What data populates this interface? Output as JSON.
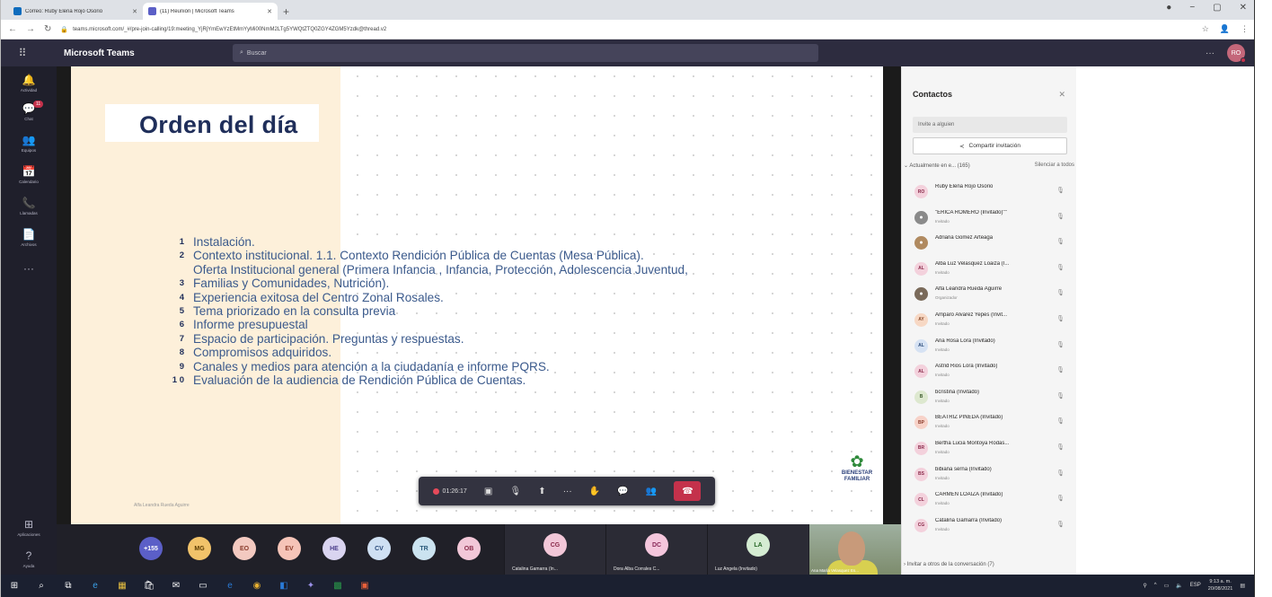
{
  "browser": {
    "tabs": [
      {
        "title": "Correo: Ruby Elena Rojo Osorio",
        "color": "#0f6cbd",
        "active": false
      },
      {
        "title": "(11) Reunión | Microsoft Teams",
        "color": "#5b5fc7",
        "active": true
      }
    ],
    "url": "teams.microsoft.com/_#/pre-join-calling/19:meeting_YjRjYmEwYzEtMmYyMi00NmM2LTg5YWQtZTQ0ZGY4ZGM5Yzdk@thread.v2"
  },
  "teams": {
    "app_title": "Microsoft Teams",
    "search_placeholder": "Buscar",
    "me_initials": "RO"
  },
  "rail": [
    {
      "label": "Actividad",
      "icon": "bell-icon",
      "glyph": "🔔"
    },
    {
      "label": "Chat",
      "icon": "chat-icon",
      "glyph": "💬",
      "badge": "11"
    },
    {
      "label": "Equipos",
      "icon": "teams-icon",
      "glyph": "👥"
    },
    {
      "label": "Calendario",
      "icon": "calendar-icon",
      "glyph": "📅"
    },
    {
      "label": "Llamadas",
      "icon": "phone-icon",
      "glyph": "📞"
    },
    {
      "label": "Archivos",
      "icon": "files-icon",
      "glyph": "📄"
    },
    {
      "label": "",
      "icon": "more-icon",
      "glyph": "···"
    }
  ],
  "rail_bottom": [
    {
      "label": "Aplicaciones",
      "icon": "apps-icon",
      "glyph": "⊞"
    },
    {
      "label": "Ayuda",
      "icon": "help-icon",
      "glyph": "?"
    }
  ],
  "slide": {
    "title": "Orden del día",
    "presenter_label": "Alfa Leandra Rueda Aguirre",
    "agenda": [
      {
        "num": "1",
        "text": "Instalación."
      },
      {
        "num": "2",
        "text": "Contexto institucional. 1.1. Contexto Rendición Pública de Cuentas (Mesa Pública)."
      },
      {
        "num": "",
        "text": "Oferta Institucional general (Primera Infancia , Infancia, Protección, Adolescencia Juventud,"
      },
      {
        "num": "3",
        "text": "Familias y Comunidades, Nutrición)."
      },
      {
        "num": "4",
        "text": "Experiencia exitosa del Centro Zonal Rosales."
      },
      {
        "num": "5",
        "text": "Tema priorizado en la consulta previa"
      },
      {
        "num": "6",
        "text": "Informe presupuestal"
      },
      {
        "num": "7",
        "text": "Espacio de participación. Preguntas y respuestas."
      },
      {
        "num": "8",
        "text": "Compromisos adquiridos."
      },
      {
        "num": "9",
        "text": "Canales y medios para atención a la ciudadanía e informe PQRS."
      },
      {
        "num": "1 0",
        "text": "Evaluación de la audiencia de Rendición Pública de Cuentas."
      }
    ],
    "logo_line1": "BIENESTAR",
    "logo_line2": "FAMILIAR",
    "colorbar": [
      "#e87a2a",
      "#47a247",
      "#3b8fd6"
    ]
  },
  "call_toolbar": {
    "timer": "01:26:17",
    "buttons": [
      {
        "name": "camera-off-button",
        "icon": "camera-off-icon",
        "glyph": "▣"
      },
      {
        "name": "mic-off-button",
        "icon": "mic-off-icon",
        "glyph": "🎙"
      },
      {
        "name": "share-button",
        "icon": "share-screen-icon",
        "glyph": "⬆"
      },
      {
        "name": "more-actions-button",
        "icon": "more-icon",
        "glyph": "···"
      },
      {
        "name": "raise-hand-button",
        "icon": "hand-icon",
        "glyph": "✋"
      },
      {
        "name": "chat-button",
        "icon": "chat-icon",
        "glyph": "💬"
      },
      {
        "name": "participants-button",
        "icon": "people-icon",
        "glyph": "👥"
      }
    ],
    "hangup_icon": "phone-hangup-icon"
  },
  "strip": {
    "avatars": [
      {
        "initials": "+155",
        "bg": "#5b5fc7",
        "fg": "#ffffff"
      },
      {
        "initials": "MG",
        "bg": "#f1c36a",
        "fg": "#5a3b00"
      },
      {
        "initials": "EO",
        "bg": "#f3c9c0",
        "fg": "#8a3a2a"
      },
      {
        "initials": "EV",
        "bg": "#f6c4b8",
        "fg": "#8a3a2a"
      },
      {
        "initials": "HE",
        "bg": "#d9d4f0",
        "fg": "#4a3d8a"
      },
      {
        "initials": "CV",
        "bg": "#cfe0f3",
        "fg": "#2a4a7a"
      },
      {
        "initials": "TR",
        "bg": "#cbe3f0",
        "fg": "#2a5a7a"
      },
      {
        "initials": "OB",
        "bg": "#f2c7d8",
        "fg": "#8a2a4a"
      }
    ],
    "tiles": [
      {
        "initials": "CG",
        "bg": "#f2c7d8",
        "fg": "#8a2a4a",
        "name": "Catalina Gamarra (In..."
      },
      {
        "initials": "DC",
        "bg": "#f4c6dc",
        "fg": "#8a2a5a",
        "name": "Dora Alba Corrales C..."
      },
      {
        "initials": "LA",
        "bg": "#d4ecd2",
        "fg": "#2a6a2a",
        "name": "Luz Angela (Invitado)"
      }
    ],
    "video_name": "Ana María Velasquez Es..."
  },
  "contacts": {
    "title": "Contactos",
    "invite_placeholder": "Invite a alguien",
    "share_label": "Compartir invitación",
    "section_label": "Actualmente en e...  (165)",
    "silence_label": "Silenciar a todos",
    "invite_more": "Invitar a otros de la conversación (7)",
    "people": [
      {
        "initials": "RO",
        "bg": "#f3d1dc",
        "fg": "#8a2a4a",
        "name": "Ruby Elena Rojo Osorio",
        "role": ""
      },
      {
        "initials": "",
        "bg": "#8a8a8a",
        "fg": "#ffffff",
        "name": "\"ERICA ROMERO (Invitado)\"\"",
        "role": "Invitado"
      },
      {
        "initials": "",
        "bg": "#b08a60",
        "fg": "#ffffff",
        "name": "Adriana Gomez Arteaga",
        "role": ""
      },
      {
        "initials": "AL",
        "bg": "#f3d1dc",
        "fg": "#8a2a4a",
        "name": "Alba Luz Velasquez Loaiza (I...",
        "role": "Invitado"
      },
      {
        "initials": "",
        "bg": "#7a6a5a",
        "fg": "#ffffff",
        "name": "Alfa Leandra Rueda Aguirre",
        "role": "Organizador"
      },
      {
        "initials": "AY",
        "bg": "#f7d8c4",
        "fg": "#8a4a2a",
        "name": "Amparo Alvarez Yepes (Invit...",
        "role": "Invitado"
      },
      {
        "initials": "AL",
        "bg": "#d6e2f3",
        "fg": "#2a4a7a",
        "name": "Ana Rosa Lora (Invitado)",
        "role": "Invitado"
      },
      {
        "initials": "AL",
        "bg": "#f3d1dc",
        "fg": "#8a2a4a",
        "name": "Astrid Rios Lora (Invitado)",
        "role": "Invitado"
      },
      {
        "initials": "B",
        "bg": "#dde8cf",
        "fg": "#3a5a2a",
        "name": "bcristina (Invitado)",
        "role": "Invitado"
      },
      {
        "initials": "BP",
        "bg": "#f7d2c8",
        "fg": "#8a3a2a",
        "name": "BEATRIZ PINEDA (Invitado)",
        "role": "Invitado"
      },
      {
        "initials": "BR",
        "bg": "#f3d1dc",
        "fg": "#8a2a4a",
        "name": "Bertha Lucia Montoya Rodas...",
        "role": "Invitado"
      },
      {
        "initials": "BS",
        "bg": "#f3d1dc",
        "fg": "#8a2a4a",
        "name": "bibiana serna (Invitado)",
        "role": "Invitado"
      },
      {
        "initials": "CL",
        "bg": "#f3d1dc",
        "fg": "#8a2a4a",
        "name": "CARMEN LOAIZA (Invitado)",
        "role": "Invitado"
      },
      {
        "initials": "CG",
        "bg": "#f3d1dc",
        "fg": "#8a2a4a",
        "name": "Catalina Gamarra (Invitado)",
        "role": "Invitado"
      }
    ]
  },
  "taskbar": {
    "apps": [
      {
        "icon": "windows-start-icon",
        "glyph": "⊞",
        "color": "#ffffff"
      },
      {
        "icon": "search-icon",
        "glyph": "⌕",
        "color": "#ffffff"
      },
      {
        "icon": "task-view-icon",
        "glyph": "⧉",
        "color": "#ffffff"
      },
      {
        "icon": "edge-icon",
        "glyph": "e",
        "color": "#3aa0e8"
      },
      {
        "icon": "app-icon",
        "glyph": "▦",
        "color": "#e8c040"
      },
      {
        "icon": "store-icon",
        "glyph": "🛍",
        "color": "#ffffff"
      },
      {
        "icon": "mail-icon",
        "glyph": "✉",
        "color": "#ffffff"
      },
      {
        "icon": "calendar-icon",
        "glyph": "▭",
        "color": "#ffffff"
      },
      {
        "icon": "ie-icon",
        "glyph": "e",
        "color": "#2a7ad6"
      },
      {
        "icon": "chrome-icon",
        "glyph": "◉",
        "color": "#e8b030"
      },
      {
        "icon": "outlook-icon",
        "glyph": "◧",
        "color": "#2a7ad6"
      },
      {
        "icon": "teams-icon",
        "glyph": "✦",
        "color": "#9a90e8"
      },
      {
        "icon": "excel-icon",
        "glyph": "▩",
        "color": "#2a9a4a"
      },
      {
        "icon": "powerpoint-icon",
        "glyph": "▣",
        "color": "#e8603a"
      }
    ],
    "lang": "ESP",
    "time": "9:13 a. m.",
    "date": "20/08/2021"
  }
}
